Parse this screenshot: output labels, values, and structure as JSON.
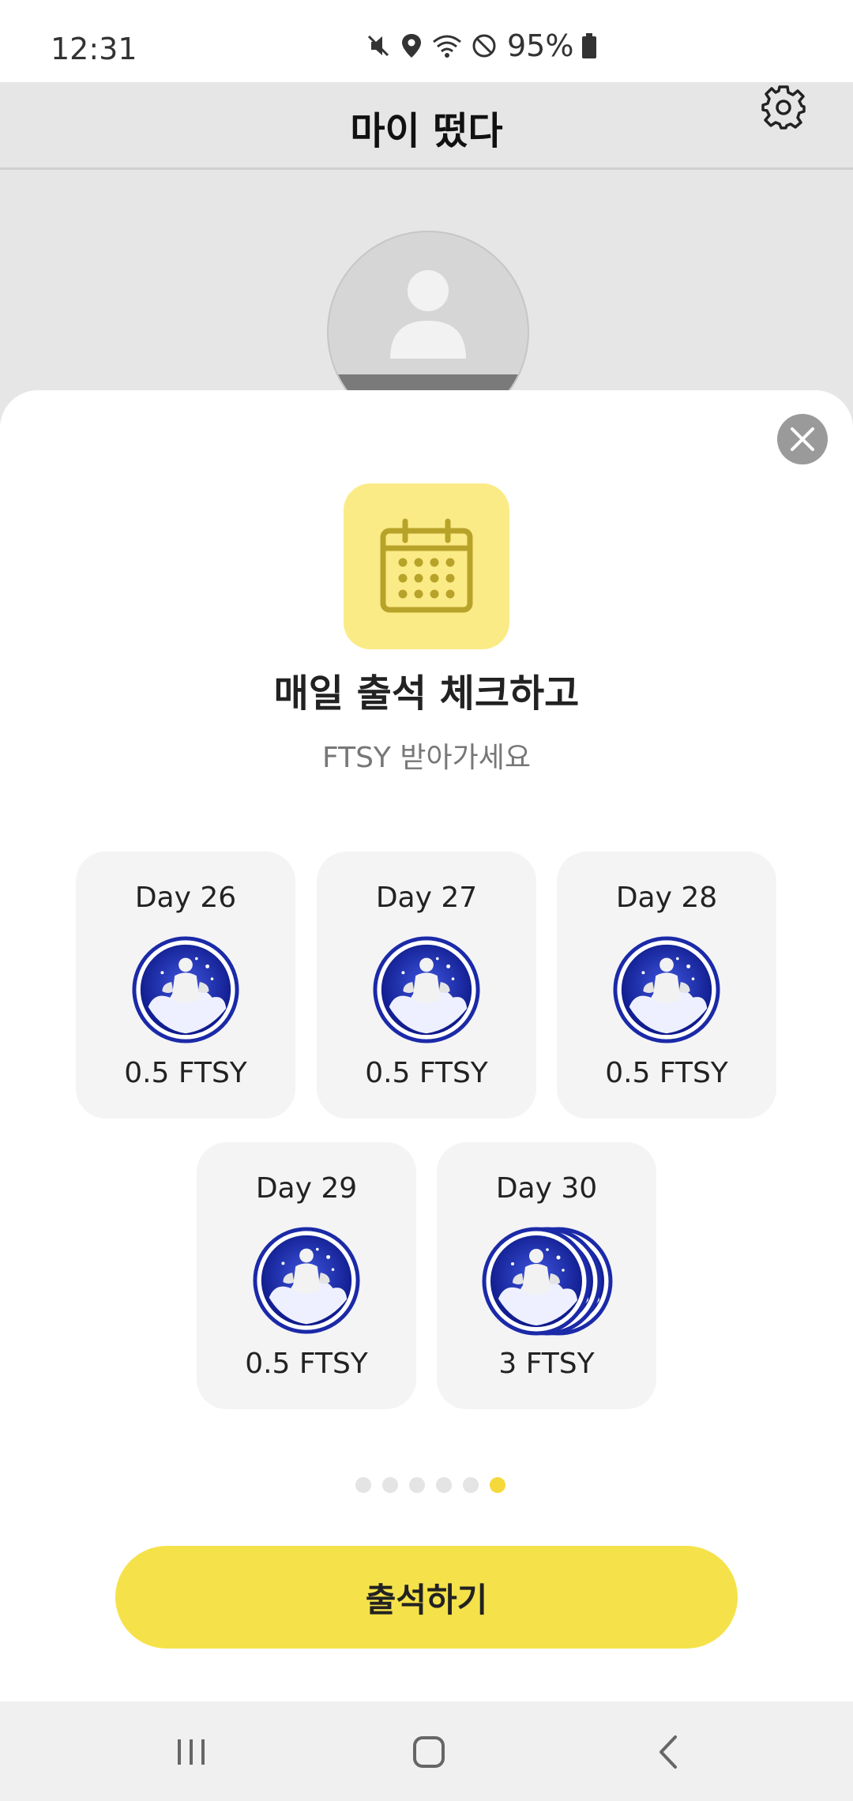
{
  "status_bar": {
    "time": "12:31",
    "battery": "95%",
    "icons": [
      "mute-icon",
      "location-icon",
      "wifi-icon",
      "do-not-disturb-icon",
      "battery-icon"
    ]
  },
  "header": {
    "title": "마이 떴다",
    "settings_icon": "gear-icon"
  },
  "modal": {
    "title": "매일 출석 체크하고",
    "subtitle": "FTSY 받아가세요",
    "close_icon": "close-icon",
    "calendar_icon": "calendar-icon",
    "days": [
      {
        "label": "Day 26",
        "reward": "0.5 FTSY",
        "coin": "single"
      },
      {
        "label": "Day 27",
        "reward": "0.5 FTSY",
        "coin": "single"
      },
      {
        "label": "Day 28",
        "reward": "0.5 FTSY",
        "coin": "single"
      },
      {
        "label": "Day 29",
        "reward": "0.5 FTSY",
        "coin": "single"
      },
      {
        "label": "Day 30",
        "reward": "3 FTSY",
        "coin": "stack"
      }
    ],
    "pager": {
      "total": 6,
      "active": 6
    },
    "button_label": "출석하기"
  },
  "nav": {
    "icons": [
      "recent-apps-icon",
      "home-icon",
      "back-icon"
    ]
  },
  "colors": {
    "accent_yellow": "#f5e24a",
    "icon_tile": "#fbeb86",
    "coin_blue": "#1b2aa8"
  }
}
